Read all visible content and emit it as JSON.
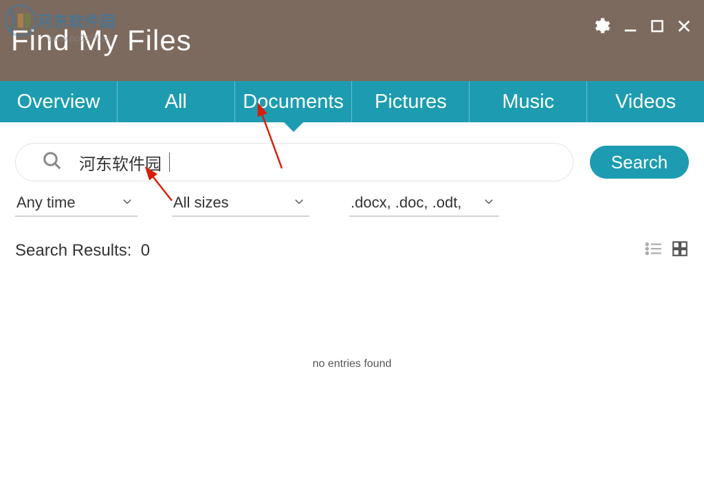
{
  "watermark": {
    "text": "河东软件园",
    "url": "www.pc0359.cn"
  },
  "header": {
    "title": "Find My Files"
  },
  "tabs": {
    "items": [
      {
        "label": "Overview"
      },
      {
        "label": "All"
      },
      {
        "label": "Documents"
      },
      {
        "label": "Pictures"
      },
      {
        "label": "Music"
      },
      {
        "label": "Videos"
      }
    ],
    "active_index": 2
  },
  "search": {
    "value": "河东软件园",
    "button_label": "Search"
  },
  "filters": {
    "time": "Any time",
    "size": "All sizes",
    "type": ".docx, .doc, .odt, .ott"
  },
  "results": {
    "label": "Search Results:",
    "count": "0",
    "empty_message": "no entries found"
  },
  "colors": {
    "titlebar": "#7d6a5e",
    "accent": "#1d9cb1",
    "annotation": "#d81e06"
  }
}
